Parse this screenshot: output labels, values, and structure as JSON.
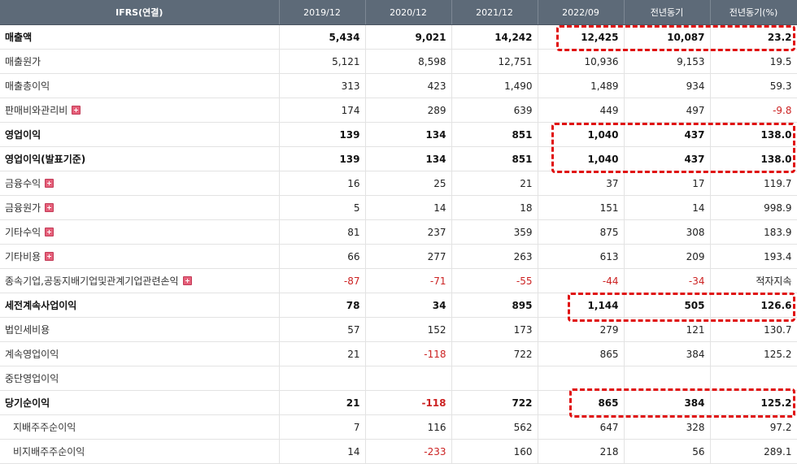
{
  "header": {
    "label": "IFRS(연결)",
    "columns": [
      "2019/12",
      "2020/12",
      "2021/12",
      "2022/09",
      "전년동기",
      "전년동기(%)"
    ]
  },
  "rows": [
    {
      "label": "매출액",
      "values": [
        "5,434",
        "9,021",
        "14,242",
        "12,425",
        "10,087",
        "23.2"
      ],
      "bold": true,
      "expand": false,
      "neg": []
    },
    {
      "label": "매출원가",
      "values": [
        "5,121",
        "8,598",
        "12,751",
        "10,936",
        "9,153",
        "19.5"
      ],
      "bold": false,
      "expand": false,
      "neg": []
    },
    {
      "label": "매출총이익",
      "values": [
        "313",
        "423",
        "1,490",
        "1,489",
        "934",
        "59.3"
      ],
      "bold": false,
      "expand": false,
      "neg": []
    },
    {
      "label": "판매비와관리비",
      "values": [
        "174",
        "289",
        "639",
        "449",
        "497",
        "-9.8"
      ],
      "bold": false,
      "expand": true,
      "neg": [
        5
      ]
    },
    {
      "label": "영업이익",
      "values": [
        "139",
        "134",
        "851",
        "1,040",
        "437",
        "138.0"
      ],
      "bold": true,
      "expand": false,
      "neg": []
    },
    {
      "label": "영업이익(발표기준)",
      "values": [
        "139",
        "134",
        "851",
        "1,040",
        "437",
        "138.0"
      ],
      "bold": true,
      "expand": false,
      "neg": []
    },
    {
      "label": "금융수익",
      "values": [
        "16",
        "25",
        "21",
        "37",
        "17",
        "119.7"
      ],
      "bold": false,
      "expand": true,
      "neg": []
    },
    {
      "label": "금융원가",
      "values": [
        "5",
        "14",
        "18",
        "151",
        "14",
        "998.9"
      ],
      "bold": false,
      "expand": true,
      "neg": []
    },
    {
      "label": "기타수익",
      "values": [
        "81",
        "237",
        "359",
        "875",
        "308",
        "183.9"
      ],
      "bold": false,
      "expand": true,
      "neg": []
    },
    {
      "label": "기타비용",
      "values": [
        "66",
        "277",
        "263",
        "613",
        "209",
        "193.4"
      ],
      "bold": false,
      "expand": true,
      "neg": []
    },
    {
      "label": "종속기업,공동지배기업및관계기업관련손익",
      "values": [
        "-87",
        "-71",
        "-55",
        "-44",
        "-34",
        "적자지속"
      ],
      "bold": false,
      "expand": true,
      "neg": [
        0,
        1,
        2,
        3,
        4
      ]
    },
    {
      "label": "세전계속사업이익",
      "values": [
        "78",
        "34",
        "895",
        "1,144",
        "505",
        "126.6"
      ],
      "bold": true,
      "expand": false,
      "neg": []
    },
    {
      "label": "법인세비용",
      "values": [
        "57",
        "152",
        "173",
        "279",
        "121",
        "130.7"
      ],
      "bold": false,
      "expand": false,
      "neg": []
    },
    {
      "label": "계속영업이익",
      "values": [
        "21",
        "-118",
        "722",
        "865",
        "384",
        "125.2"
      ],
      "bold": false,
      "expand": false,
      "neg": [
        1
      ]
    },
    {
      "label": "중단영업이익",
      "values": [
        "",
        "",
        "",
        "",
        "",
        ""
      ],
      "bold": false,
      "expand": false,
      "neg": []
    },
    {
      "label": "당기순이익",
      "values": [
        "21",
        "-118",
        "722",
        "865",
        "384",
        "125.2"
      ],
      "bold": true,
      "expand": false,
      "neg": [
        1
      ]
    },
    {
      "label": "지배주주순이익",
      "values": [
        "7",
        "116",
        "562",
        "647",
        "328",
        "97.2"
      ],
      "bold": false,
      "expand": false,
      "indent": true,
      "neg": []
    },
    {
      "label": "비지배주주순이익",
      "values": [
        "14",
        "-233",
        "160",
        "218",
        "56",
        "289.1"
      ],
      "bold": false,
      "expand": false,
      "indent": true,
      "neg": [
        1
      ]
    }
  ],
  "colors": {
    "header_bg": "#5d6a78",
    "negative": "#cc2222",
    "highlight": "#e01010",
    "expand_icon": "#e5607a"
  }
}
